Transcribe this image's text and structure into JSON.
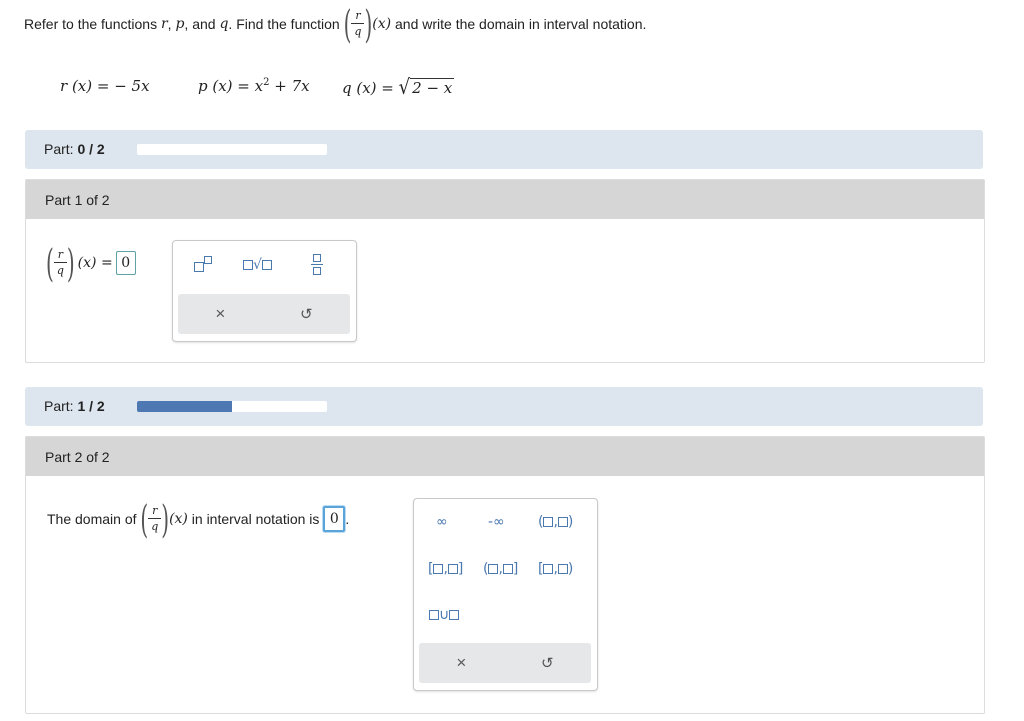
{
  "question": {
    "prefix": "Refer to the functions",
    "var_r": "r",
    "comma1": ",",
    "var_p": "p",
    "comma_and": ", and",
    "var_q": "q",
    "find": ". Find the function",
    "frac_num": "r",
    "frac_den": "q",
    "arg": "(x)",
    "suffix": "and write the domain in interval notation."
  },
  "definitions": {
    "r": "r (x) = − 5x",
    "p_lhs": "p (x) = x",
    "p_exp": "2",
    "p_rhs": "+ 7x",
    "q_lhs": "q (x) =",
    "q_radicand": "2 − x"
  },
  "part1_status": {
    "label": "Part:",
    "progress": "0 / 2",
    "fill_fraction": 0.0
  },
  "part1": {
    "heading": "Part 1 of 2",
    "frac_num": "r",
    "frac_den": "q",
    "arg": "(x) =",
    "answer_value": "0"
  },
  "part2_status": {
    "label": "Part:",
    "progress": "1 / 2",
    "fill_fraction": 0.5
  },
  "part2": {
    "heading": "Part 2 of 2",
    "text_before": "The domain of",
    "frac_num": "r",
    "frac_den": "q",
    "arg": "(x)",
    "text_after": "in interval notation is",
    "answer_value": "0",
    "period": "."
  },
  "palette2": {
    "infinity": "∞",
    "neg_infinity": "-∞",
    "open_open": [
      "(",
      ",",
      ")"
    ],
    "closed_closed": [
      "[",
      ",",
      "]"
    ],
    "open_closed": [
      "(",
      ",",
      "]"
    ],
    "closed_open": [
      "[",
      ",",
      ")"
    ],
    "union": "∪"
  },
  "tools": {
    "clear": "×",
    "undo": "↺"
  },
  "colors": {
    "accent": "#4a79b0",
    "status_bg": "#dde6ee",
    "progress_fill": "#4d78b2",
    "part_head": "#d6d6d6"
  }
}
